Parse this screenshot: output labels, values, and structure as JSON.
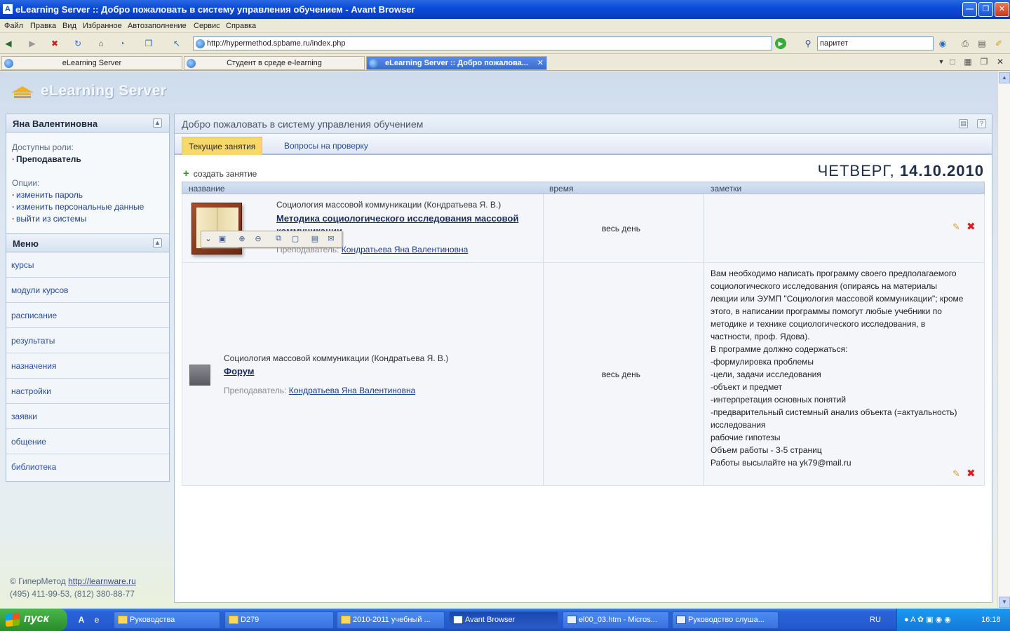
{
  "window": {
    "title": "eLearning Server :: Добро пожаловать в систему управления обучением - Avant Browser",
    "app_icon": "avant-icon"
  },
  "menu": [
    "Файл",
    "Правка",
    "Вид",
    "Избранное",
    "Автозаполнение",
    "Сервис",
    "Справка"
  ],
  "toolbar": {
    "address": "http://hypermethod.spbame.ru/index.php",
    "search_value": "паритет"
  },
  "browser_tabs": [
    {
      "label": "eLearning Server"
    },
    {
      "label": "Студент в среде e-learning"
    },
    {
      "label": "eLearning Server :: Добро пожалова..."
    }
  ],
  "logo": {
    "text": "eLearning Server"
  },
  "user_box": {
    "name": "Яна Валентиновна",
    "roles_label": "Доступны роли:",
    "role": "Преподаватель",
    "options_label": "Опции:",
    "options": [
      "изменить пароль",
      "изменить персональные данные",
      "выйти из системы"
    ]
  },
  "menu_box": {
    "title": "Меню",
    "items": [
      "курсы",
      "модули курсов",
      "расписание",
      "результаты",
      "назначения",
      "настройки",
      "заявки",
      "общение",
      "библиотека"
    ]
  },
  "footer": {
    "copyright": "© ГиперМетод",
    "link": "http://learnware.ru",
    "phones": "(495) 411-99-53, (812) 380-88-77"
  },
  "main": {
    "title": "Добро пожаловать в систему управления обучением",
    "tabs": [
      "Текущие занятия",
      "Вопросы на проверку"
    ],
    "create_label": "создать занятие",
    "date_day": "ЧЕТВЕРГ,",
    "date_value": "14.10.2010",
    "columns": [
      "название",
      "время",
      "заметки"
    ],
    "rows": [
      {
        "course": "Социология массовой коммуникации (Кондратьева Я. В.)",
        "lesson": "Методика социологического исследования массовой коммуникации",
        "teacher_label": "Преподаватель:",
        "teacher": "Кондратьева Яна Валентиновна",
        "time": "весь день",
        "notes": []
      },
      {
        "course": "Социология массовой коммуникации (Кондратьева Я. В.)",
        "lesson": "Форум",
        "teacher_label": "Преподаватель:",
        "teacher": "Кондратьева Яна Валентиновна",
        "time": "весь день",
        "notes": [
          "Вам необходимо написать программу своего предполагаемого",
          "социологического исследования (опираясь на материалы",
          "лекции или ЭУМП \"Социология массовой коммуникации\"; кроме",
          "этого, в написании программы помогут любые учебники по",
          "методике и технике социологического исследования, в",
          "частности, проф. Ядова).",
          "В программе должно содержаться:",
          "-формулировка проблемы",
          "-цели, задачи исследования",
          "-объект и предмет",
          "-интерпретация основных понятий",
          "-предварительный системный анализ объекта (=актуальность)",
          "исследования",
          "рабочие гипотезы",
          "Объем работы - 3-5 страниц",
          "Работы высылайте на yk79@mail.ru"
        ]
      }
    ]
  },
  "taskbar": {
    "start": "пуск",
    "tasks": [
      "Руководства",
      "D279",
      "2010-2011 учебный ...",
      "Avant Browser",
      "el00_03.htm - Micros...",
      "Руководство слуша..."
    ],
    "lang": "RU",
    "clock": "16:18"
  }
}
